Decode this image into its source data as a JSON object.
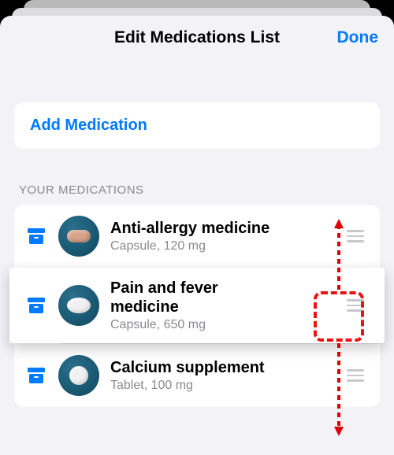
{
  "nav": {
    "title": "Edit Medications List",
    "done": "Done"
  },
  "add": {
    "label": "Add Medication"
  },
  "section": {
    "header": "Your Medications"
  },
  "meds": [
    {
      "name": "Anti-allergy medicine",
      "detail": "Capsule, 120 mg",
      "pill_color": "teal",
      "pill_shape": "capsule"
    },
    {
      "name": "Pain and fever medicine",
      "detail": "Capsule, 650 mg",
      "pill_color": "teal",
      "pill_shape": "oval",
      "lifted": true
    },
    {
      "name": "Calcium supplement",
      "detail": "Tablet, 100 mg",
      "pill_color": "teal",
      "pill_shape": "round"
    }
  ],
  "icons": {
    "archive": "archive-box-icon",
    "drag": "drag-handle-icon"
  },
  "colors": {
    "accent": "#007aff"
  }
}
